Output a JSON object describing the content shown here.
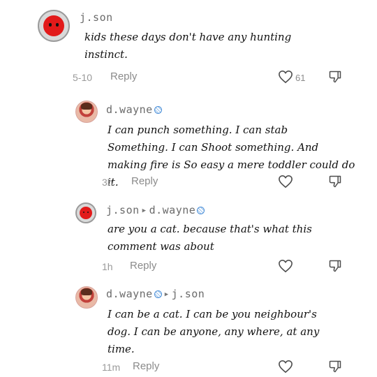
{
  "comments": [
    {
      "username": "j.son",
      "text_lines": [
        "kids these days don't have any hunting",
        "instinct."
      ],
      "time": "5-10",
      "reply_label": "Reply",
      "likes": "61"
    },
    {
      "username": "d.wayne",
      "text_lines": [
        "I can punch something. I can stab",
        "Something. I can Shoot something. And",
        "making fire is So easy a mere toddler could do it."
      ],
      "time": "3h",
      "reply_label": "Reply"
    },
    {
      "username": "j.son",
      "reply_to": "d.wayne",
      "text_lines": [
        "are you a cat. because that's what this",
        "comment was about"
      ],
      "time": "1h",
      "reply_label": "Reply"
    },
    {
      "username": "d.wayne",
      "reply_to": "j.son",
      "text_lines": [
        "I can be a cat. I can be you neighbour's",
        "dog. I can be anyone, any where, at any",
        "time."
      ],
      "time": "11m",
      "reply_label": "Reply"
    }
  ],
  "icons": {
    "like": "heart-outline-icon",
    "dislike": "thumbs-down-outline-icon",
    "verified": "verified-badge-icon",
    "reply_arrow": "reply-arrow-icon"
  },
  "colors": {
    "avatar_red": "#e21a1a",
    "badge_blue": "#4a8fd8",
    "meta_gray": "#9a9a9a"
  }
}
